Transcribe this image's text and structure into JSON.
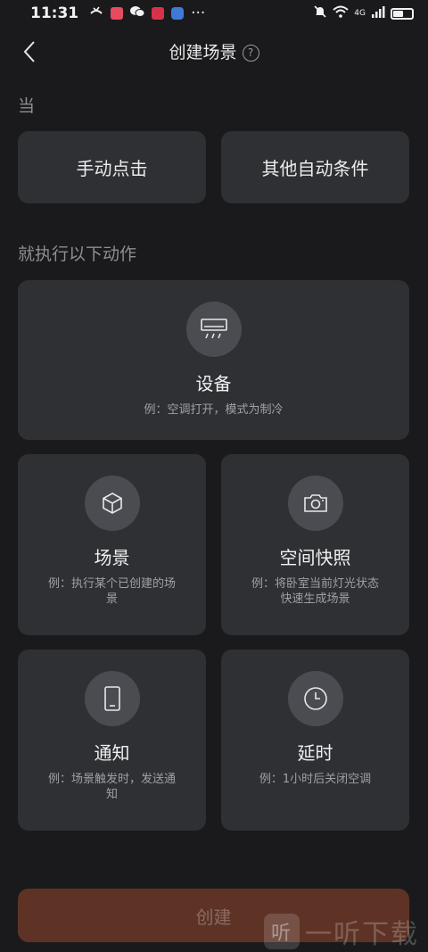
{
  "status": {
    "time": "11:31",
    "ellipsis": "···",
    "network": "4G"
  },
  "nav": {
    "title": "创建场景",
    "help": "?"
  },
  "when_label": "当",
  "triggers": [
    {
      "label": "手动点击"
    },
    {
      "label": "其他自动条件"
    }
  ],
  "then_label": "就执行以下动作",
  "actions": {
    "device": {
      "title": "设备",
      "desc": "例：空调打开，模式为制冷",
      "icon": "air-conditioner-icon"
    },
    "scene": {
      "title": "场景",
      "desc": "例：执行某个已创建的场景",
      "icon": "cube-icon"
    },
    "snapshot": {
      "title": "空间快照",
      "desc": "例：将卧室当前灯光状态快速生成场景",
      "icon": "camera-icon"
    },
    "notify": {
      "title": "通知",
      "desc": "例：场景触发时，发送通知",
      "icon": "phone-icon"
    },
    "delay": {
      "title": "延时",
      "desc": "例：1小时后关闭空调",
      "icon": "clock-icon"
    }
  },
  "create_button": "创建",
  "watermark": {
    "logo": "听",
    "text": "一听下载"
  },
  "colors": {
    "background": "#1a1a1c",
    "card": "#2e3034",
    "create_button": "#5e3326"
  }
}
